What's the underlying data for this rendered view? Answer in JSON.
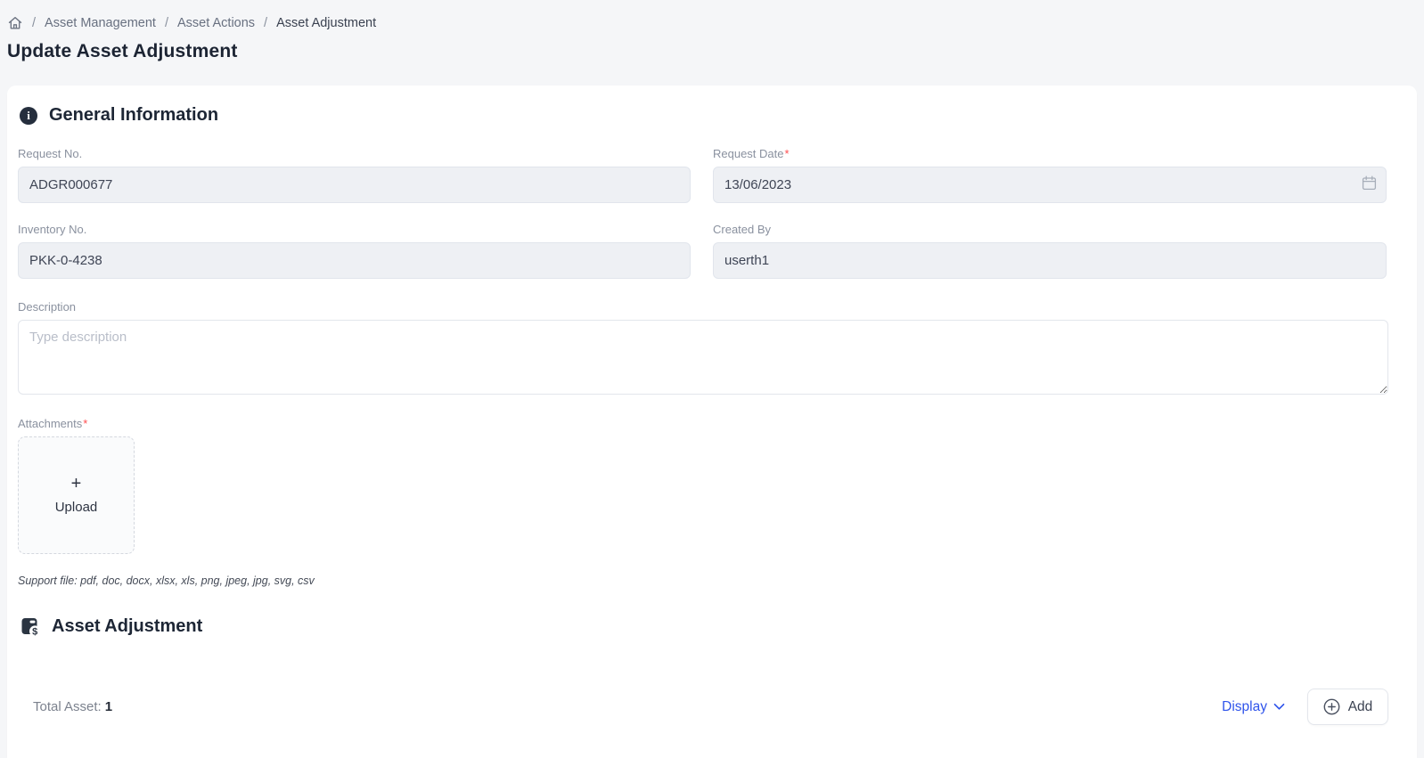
{
  "breadcrumb": {
    "separator": "/",
    "items": [
      "Asset Management",
      "Asset Actions",
      "Asset Adjustment"
    ]
  },
  "page": {
    "title": "Update Asset Adjustment"
  },
  "general_info": {
    "section_title": "General Information",
    "fields": {
      "request_no": {
        "label": "Request No.",
        "value": "ADGR000677"
      },
      "request_date": {
        "label": "Request Date",
        "required": "*",
        "value": "13/06/2023"
      },
      "inventory_no": {
        "label": "Inventory No.",
        "value": "PKK-0-4238"
      },
      "created_by": {
        "label": "Created By",
        "value": "userth1"
      },
      "description": {
        "label": "Description",
        "placeholder": "Type description",
        "value": ""
      }
    },
    "attachments": {
      "label": "Attachments",
      "required": "*",
      "upload_plus": "+",
      "upload_label": "Upload",
      "support_text": "Support file: pdf, doc, docx, xlsx, xls, png, jpeg, jpg, svg, csv"
    }
  },
  "asset_adjustment": {
    "section_title": "Asset Adjustment",
    "icon_dollar": "$",
    "total_label": "Total Asset:",
    "total_value": "1",
    "display_label": "Display",
    "add_label": "Add"
  },
  "icons": {
    "info_glyph": "i"
  },
  "colors": {
    "accent_blue": "#2f54eb",
    "required_red": "#ff4d4f",
    "input_bg": "#eef0f4",
    "section_text": "#1d2635",
    "page_bg": "#f5f6f8"
  }
}
